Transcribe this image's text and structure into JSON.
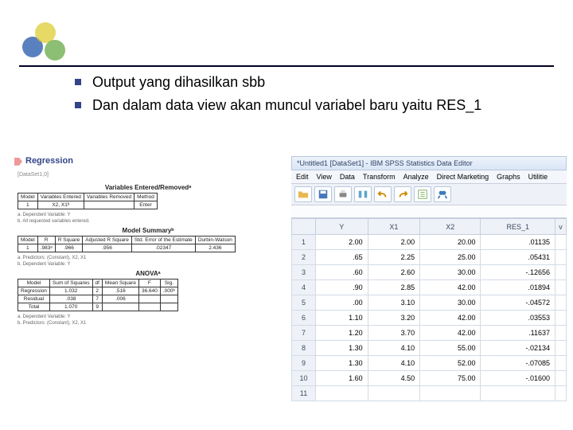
{
  "bullets": {
    "b1": "Output yang dihasilkan sbb",
    "b2": "Dan dalam data view akan muncul variabel baru yaitu RES_1"
  },
  "output": {
    "title": "Regression",
    "dataset": "[DataSet1,0]",
    "varEntered": {
      "caption": "Variables Entered/Removedᵃ",
      "h0": "Model",
      "h1": "Variables Entered",
      "h2": "Variables Removed",
      "h3": "Method",
      "r0": "1",
      "r1": "X2, X1ᵇ",
      "r2": "",
      "r3": "Enter",
      "fa": "a. Dependent Variable: Y",
      "fb": "b. All requested variables entered."
    },
    "modelSummary": {
      "caption": "Model Summaryᵇ",
      "h0": "Model",
      "h1": "R",
      "h2": "R Square",
      "h3": "Adjusted R Square",
      "h4": "Std. Error of the Estimate",
      "h5": "Durbin-Watson",
      "r0": "1",
      "r1": ".983ᵃ",
      "r2": ".966",
      "r3": ".956",
      "r4": ".02347",
      "r5": "2.436",
      "fa": "a. Predictors: (Constant), X2, X1",
      "fb": "b. Dependent Variable: Y"
    },
    "anova": {
      "caption": "ANOVAᵃ",
      "h0": "Model",
      "h1": "Sum of Squares",
      "h2": "df",
      "h3": "Mean Square",
      "h4": "F",
      "h5": "Sig.",
      "r10": "Regression",
      "r11": "1.032",
      "r12": "2",
      "r13": ".516",
      "r14": "36.640",
      "r15": ".000ᵇ",
      "r20": "Residual",
      "r21": ".038",
      "r22": "7",
      "r23": ".006",
      "r24": "",
      "r25": "",
      "r30": "Total",
      "r31": "1.070",
      "r32": "9",
      "r33": "",
      "r34": "",
      "r35": "",
      "fa": "a. Dependent Variable: Y",
      "fb": "b. Predictors: (Constant), X2, X1"
    }
  },
  "editor": {
    "title": "*Untitled1 [DataSet1] - IBM SPSS Statistics Data Editor",
    "menu": {
      "edit": "Edit",
      "view": "View",
      "data": "Data",
      "transform": "Transform",
      "analyze": "Analyze",
      "dm": "Direct Marketing",
      "graphs": "Graphs",
      "utilities": "Utilitie"
    },
    "cols": {
      "y": "Y",
      "x1": "X1",
      "x2": "X2",
      "res": "RES_1",
      "extra": "v"
    },
    "rows": [
      {
        "n": "1",
        "y": "2.00",
        "x1": "2.00",
        "x2": "20.00",
        "res": ".01135"
      },
      {
        "n": "2",
        "y": ".65",
        "x1": "2.25",
        "x2": "25.00",
        "res": ".05431"
      },
      {
        "n": "3",
        "y": ".60",
        "x1": "2.60",
        "x2": "30.00",
        "res": "-.12656"
      },
      {
        "n": "4",
        "y": ".90",
        "x1": "2.85",
        "x2": "42.00",
        "res": ".01894"
      },
      {
        "n": "5",
        "y": ".00",
        "x1": "3.10",
        "x2": "30.00",
        "res": "-.04572"
      },
      {
        "n": "6",
        "y": "1.10",
        "x1": "3.20",
        "x2": "42.00",
        "res": ".03553"
      },
      {
        "n": "7",
        "y": "1.20",
        "x1": "3.70",
        "x2": "42.00",
        "res": ".11637"
      },
      {
        "n": "8",
        "y": "1.30",
        "x1": "4.10",
        "x2": "55.00",
        "res": "-.02134"
      },
      {
        "n": "9",
        "y": "1.30",
        "x1": "4.10",
        "x2": "52.00",
        "res": "-.07085"
      },
      {
        "n": "10",
        "y": "1.60",
        "x1": "4.50",
        "x2": "75.00",
        "res": "-.01600"
      },
      {
        "n": "11",
        "y": "",
        "x1": "",
        "x2": "",
        "res": ""
      }
    ]
  }
}
